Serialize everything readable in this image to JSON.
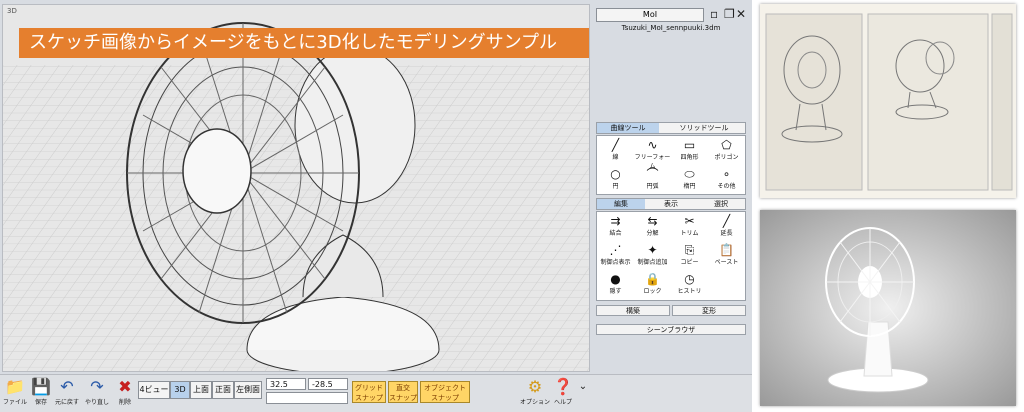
{
  "app": {
    "title": "MoI",
    "file_name": "Tsuzuki_MoI_sennpuuki.3dm",
    "window_controls": [
      "restore",
      "maximize",
      "close"
    ]
  },
  "viewport": {
    "label": "3D",
    "banner": "スケッチ画像からイメージをもとに3D化したモデリングサンプル"
  },
  "toolbar": {
    "file": "ファイル",
    "save": "保存",
    "undo": "元に戻す",
    "redo": "やり直し",
    "delete": "削除",
    "views": [
      "4ビュー",
      "3D",
      "上面",
      "正面",
      "左側面"
    ],
    "active_view": "3D",
    "coord_x": "32.5",
    "coord_y": "-28.5",
    "coord_z": "",
    "grid_snap": "グリッド\nスナップ",
    "intersect_snap": "直交\nスナップ",
    "object_snap": "オブジェクト\nスナップ",
    "options": "オプション",
    "help": "ヘルプ"
  },
  "panel": {
    "tabs1": [
      "曲線ツール",
      "ソリッドツール"
    ],
    "curve_tools": [
      {
        "label": "線",
        "icon": "line-icon"
      },
      {
        "label": "フリーフォーム",
        "icon": "freeform-icon"
      },
      {
        "label": "四角形",
        "icon": "rectangle-icon"
      },
      {
        "label": "ポリゴン",
        "icon": "polygon-icon"
      },
      {
        "label": "円",
        "icon": "circle-icon"
      },
      {
        "label": "円弧",
        "icon": "arc-icon"
      },
      {
        "label": "楕円",
        "icon": "ellipse-icon"
      },
      {
        "label": "その他",
        "icon": "more-icon"
      }
    ],
    "tabs2": [
      "編集",
      "表示",
      "選択"
    ],
    "edit_tools": [
      {
        "label": "結合",
        "icon": "join-icon"
      },
      {
        "label": "分解",
        "icon": "separate-icon"
      },
      {
        "label": "トリム",
        "icon": "trim-icon"
      },
      {
        "label": "延長",
        "icon": "extend-icon"
      },
      {
        "label": "制御点表示",
        "icon": "show-points-icon"
      },
      {
        "label": "制御点追加",
        "icon": "add-point-icon"
      },
      {
        "label": "コピー",
        "icon": "copy-icon"
      },
      {
        "label": "ペースト",
        "icon": "paste-icon"
      },
      {
        "label": "隠す",
        "icon": "hide-icon"
      },
      {
        "label": "ロック",
        "icon": "lock-icon"
      },
      {
        "label": "ヒストリ",
        "icon": "history-icon"
      }
    ],
    "transform": "構築",
    "deform": "変形",
    "scene_browser": "シーンブラウザ"
  }
}
